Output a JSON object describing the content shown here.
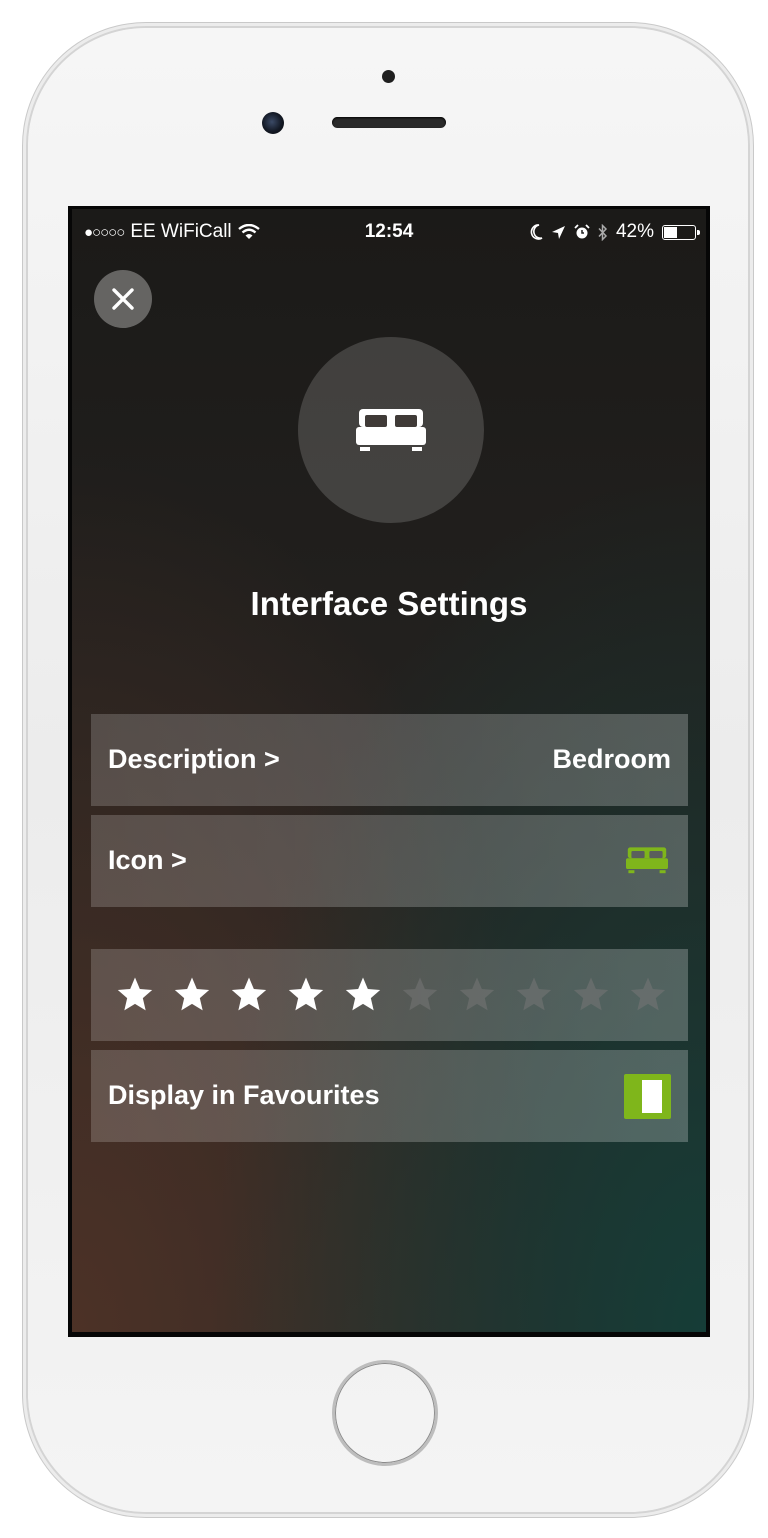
{
  "status_bar": {
    "signal": "●○○○○",
    "carrier": "EE WiFiCall",
    "wifi_icon": "wifi-icon",
    "time": "12:54",
    "icons": [
      "moon-icon",
      "location-arrow-icon",
      "alarm-clock-icon",
      "bluetooth-icon"
    ],
    "battery_percent": "42%",
    "battery_level": 0.42
  },
  "header": {
    "close_icon": "close-icon",
    "hero_icon": "bed-icon",
    "title": "Interface Settings"
  },
  "settings": {
    "description": {
      "label": "Description  >",
      "value": "Bedroom"
    },
    "icon": {
      "label": "Icon  >",
      "value_icon": "bed-icon",
      "icon_color": "#7fb61b"
    },
    "rating": {
      "filled": 5,
      "total": 10
    },
    "favourites": {
      "label": "Display in Favourites",
      "enabled": true
    }
  },
  "colors": {
    "accent": "#7fb61b",
    "star_filled": "#ffffff",
    "star_empty": "#777777"
  }
}
